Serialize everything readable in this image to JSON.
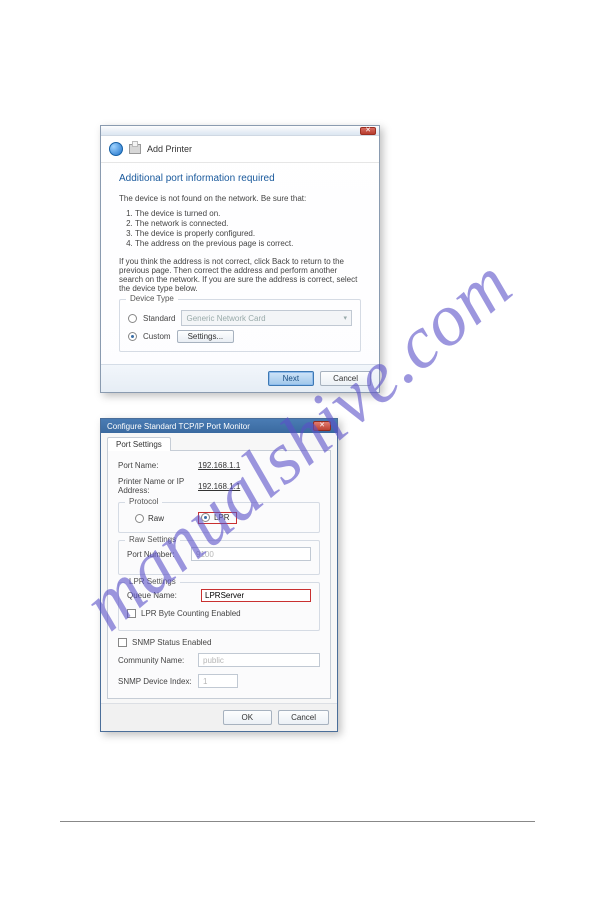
{
  "watermark": "manualshive.com",
  "dlg1": {
    "breadcrumb_label": "Add Printer",
    "heading": "Additional port information required",
    "intro": "The device is not found on the network. Be sure that:",
    "checklist": [
      "The device is turned on.",
      "The network is connected.",
      "The device is properly configured.",
      "The address on the previous page is correct."
    ],
    "note": "If you think the address is not correct, click Back to return to the previous page. Then correct the address and perform another search on the network. If you are sure the address is correct, select the device type below.",
    "device_type_legend": "Device Type",
    "standard_label": "Standard",
    "standard_select_value": "Generic Network Card",
    "custom_label": "Custom",
    "settings_btn": "Settings...",
    "next_btn": "Next",
    "cancel_btn": "Cancel"
  },
  "dlg2": {
    "title": "Configure Standard TCP/IP Port Monitor",
    "tab_label": "Port Settings",
    "port_name_label": "Port Name:",
    "port_name_value": "192.168.1.1",
    "printer_label": "Printer Name or IP Address:",
    "printer_value": "192.168.1.1",
    "protocol_legend": "Protocol",
    "proto_raw": "Raw",
    "proto_lpr": "LPR",
    "raw_legend": "Raw Settings",
    "port_number_label": "Port Number:",
    "port_number_value": "9100",
    "lpr_legend": "LPR Settings",
    "queue_label": "Queue Name:",
    "queue_value": "LPRServer",
    "lpr_byte_label": "LPR Byte Counting Enabled",
    "snmp_label": "SNMP Status Enabled",
    "community_label": "Community Name:",
    "community_value": "public",
    "snmp_index_label": "SNMP Device Index:",
    "snmp_index_value": "1",
    "ok_btn": "OK",
    "cancel_btn": "Cancel"
  }
}
